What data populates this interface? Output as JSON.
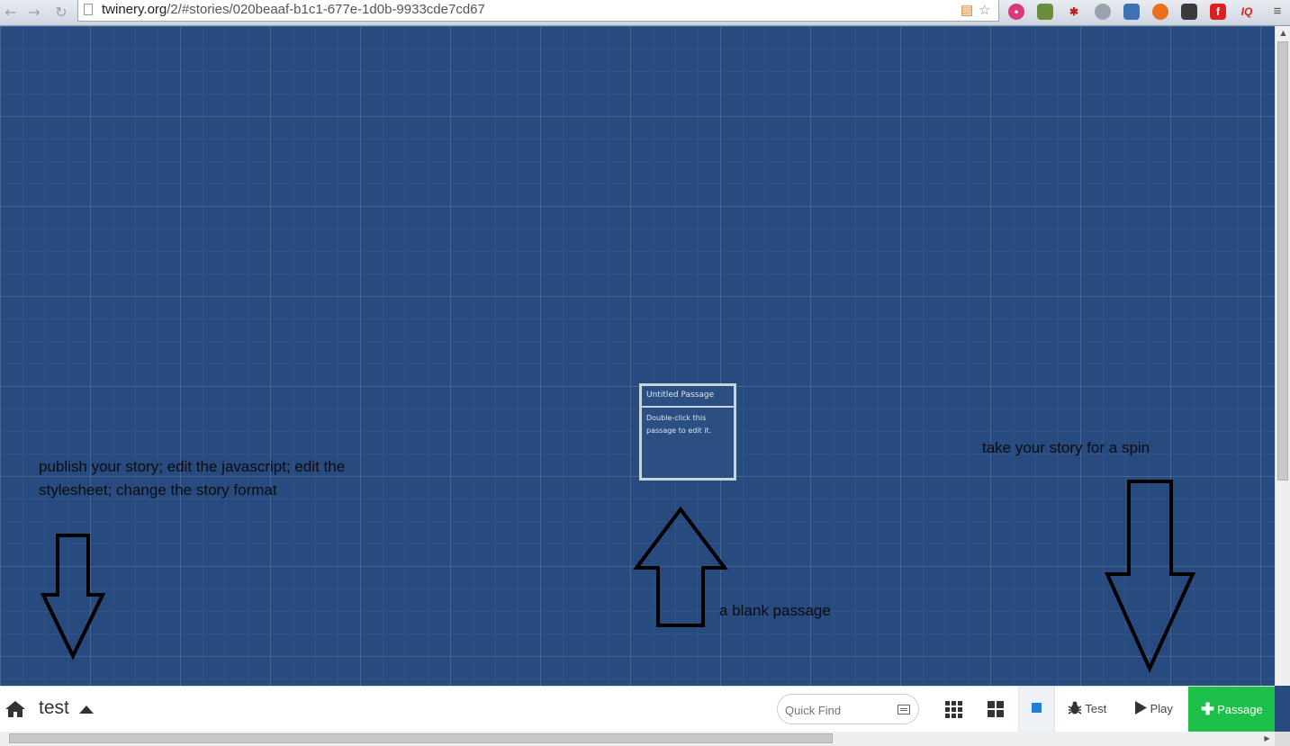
{
  "browser": {
    "url_domain": "twinery.org",
    "url_path": "/2/#stories/020beaaf-b1c1-677e-1d0b-9933cde7cd67"
  },
  "story_map": {
    "passage": {
      "title": "Untitled Passage",
      "excerpt": "Double-click this passage to edit it."
    },
    "annotations": {
      "left": "publish your story; edit the javascript; edit the stylesheet; change the story format",
      "center": "a blank passage",
      "right": "take your story for a spin"
    }
  },
  "toolbar": {
    "story_title": "test",
    "quick_find_placeholder": "Quick Find",
    "test_label": "Test",
    "play_label": "Play",
    "passage_label": "Passage"
  },
  "colors": {
    "map_background": "#274a7f",
    "passage_button": "#1dc048",
    "active_zoom": "#1e7fd6"
  },
  "icons": {
    "home": "home-icon",
    "story_menu": "caret-up-icon",
    "quick_find_options": "list-icon",
    "zoom_small": "grid-3x3-icon",
    "zoom_medium": "grid-2x2-icon",
    "zoom_large": "square-icon",
    "test": "bug-icon",
    "play": "play-icon",
    "add_passage": "plus-icon"
  }
}
